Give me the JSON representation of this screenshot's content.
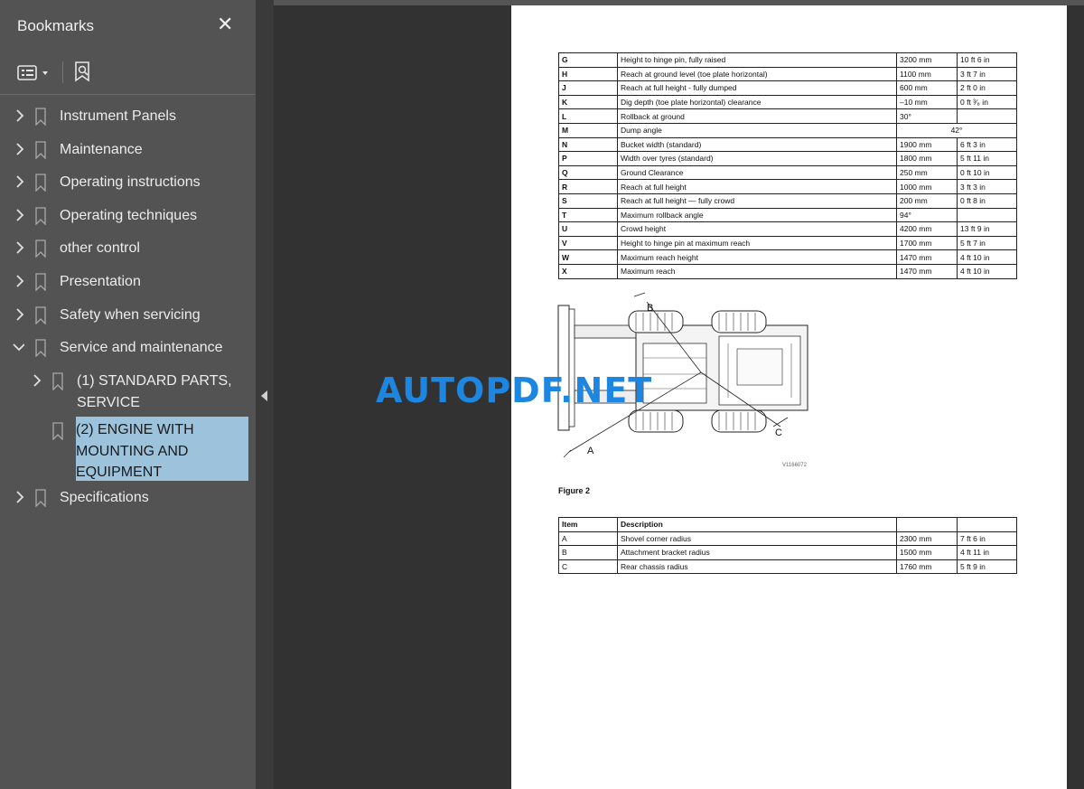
{
  "sidebar": {
    "title": "Bookmarks",
    "items": [
      {
        "label": "Instrument Panels"
      },
      {
        "label": "Maintenance"
      },
      {
        "label": "Operating instructions"
      },
      {
        "label": "Operating techniques"
      },
      {
        "label": "other control"
      },
      {
        "label": "Presentation"
      },
      {
        "label": "Safety when servicing"
      },
      {
        "label": "Service and maintenance"
      },
      {
        "label": "(1) STANDARD PARTS, SERVICE"
      },
      {
        "label": "(2) ENGINE WITH MOUNTING AND EQUIPMENT"
      },
      {
        "label": "Specifications"
      }
    ]
  },
  "document": {
    "table1": [
      [
        "G",
        "Height to hinge pin, fully raised",
        "3200 mm",
        "10 ft 6 in"
      ],
      [
        "H",
        "Reach at ground level (toe plate horizontal)",
        "1100 mm",
        "3 ft 7 in"
      ],
      [
        "J",
        "Reach at full height - fully dumped",
        "600 mm",
        "2 ft 0 in"
      ],
      [
        "K",
        "Dig depth (toe plate horizontal) clearance",
        "–10 mm",
        "0 ft ³⁄₈ in"
      ],
      [
        "L",
        "Rollback at ground",
        "30°",
        ""
      ],
      [
        "M",
        "Dump angle",
        "42°",
        ""
      ],
      [
        "N",
        "Bucket width (standard)",
        "1900 mm",
        "6 ft 3 in"
      ],
      [
        "P",
        "Width over tyres (standard)",
        "1800 mm",
        "5 ft 11 in"
      ],
      [
        "Q",
        "Ground Clearance",
        "250 mm",
        "0 ft 10 in"
      ],
      [
        "R",
        "Reach at full height",
        "1000 mm",
        "3 ft 3 in"
      ],
      [
        "S",
        "Reach at full height — fully crowd",
        "200 mm",
        "0 ft 8 in"
      ],
      [
        "T",
        "Maximum rollback angle",
        "94°",
        ""
      ],
      [
        "U",
        "Crowd height",
        "4200 mm",
        "13 ft 9 in"
      ],
      [
        "V",
        "Height to hinge pin at maximum reach",
        "1700 mm",
        "5 ft 7 in"
      ],
      [
        "W",
        "Maximum reach height",
        "1470 mm",
        "4 ft 10 in"
      ],
      [
        "X",
        "Maximum reach",
        "1470 mm",
        "4 ft 10 in"
      ]
    ],
    "figure": {
      "label_a": "A",
      "label_b": "B",
      "label_c": "C",
      "code": "V1166072",
      "caption": "Figure 2"
    },
    "table2_header": [
      "Item",
      "Description",
      "",
      ""
    ],
    "table2": [
      [
        "A",
        "Shovel corner radius",
        "2300 mm",
        "7 ft 6 in"
      ],
      [
        "B",
        "Attachment bracket radius",
        "1500 mm",
        "4 ft 11 in"
      ],
      [
        "C",
        "Rear chassis radius",
        "1760 mm",
        "5 ft 9 in"
      ]
    ],
    "watermark": "AUTOPDF.NET"
  }
}
